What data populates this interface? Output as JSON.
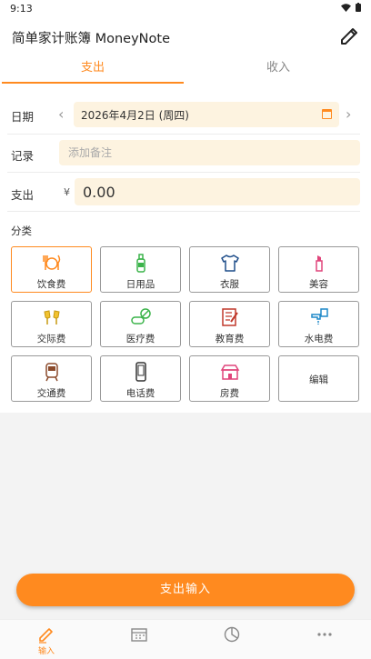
{
  "status_bar": {
    "time": "9:13"
  },
  "app": {
    "title": "简单家计账簿 MoneyNote"
  },
  "tabs": [
    {
      "label": "支出",
      "active": true
    },
    {
      "label": "收入",
      "active": false
    }
  ],
  "form": {
    "date_label": "日期",
    "date_value": "2026年4月2日 (周四)",
    "note_label": "记录",
    "note_placeholder": "添加备注",
    "amount_label": "支出",
    "currency_symbol": "¥",
    "amount_value": "0.00",
    "category_label": "分类"
  },
  "categories": [
    {
      "name": "饮食费",
      "icon": "food-icon",
      "selected": true
    },
    {
      "name": "日用品",
      "icon": "bottle-icon"
    },
    {
      "name": "衣服",
      "icon": "shirt-icon"
    },
    {
      "name": "美容",
      "icon": "lipstick-icon"
    },
    {
      "name": "交际费",
      "icon": "cheers-icon"
    },
    {
      "name": "医疗费",
      "icon": "medicine-icon"
    },
    {
      "name": "教育费",
      "icon": "book-icon"
    },
    {
      "name": "水电费",
      "icon": "faucet-icon"
    },
    {
      "name": "交通费",
      "icon": "train-icon"
    },
    {
      "name": "电话费",
      "icon": "phone-icon"
    },
    {
      "name": "房费",
      "icon": "house-icon"
    },
    {
      "name": "编辑",
      "icon": ""
    }
  ],
  "submit_label": "支出输入",
  "bottom_nav": [
    {
      "label": "输入",
      "icon": "pencil-icon",
      "active": true
    },
    {
      "label": "",
      "icon": "calendar-icon"
    },
    {
      "label": "",
      "icon": "pie-chart-icon"
    },
    {
      "label": "",
      "icon": "more-icon"
    }
  ],
  "colors": {
    "accent": "#ff8a1f",
    "field_bg": "#fdf3e0"
  }
}
